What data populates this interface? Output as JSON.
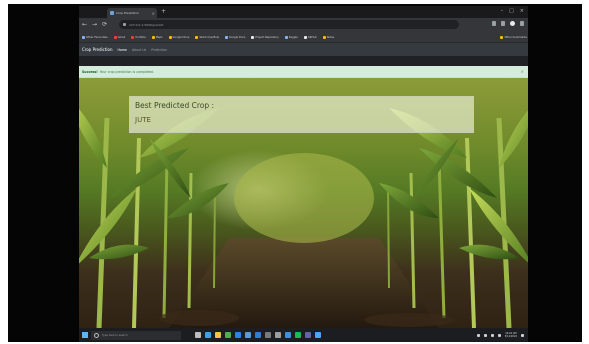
{
  "browser": {
    "tab_title": "Crop Prediction",
    "tab_close": "×",
    "new_tab": "+",
    "window_controls": [
      "–",
      "□",
      "×"
    ],
    "nav_buttons": [
      "←",
      "→",
      "⟳"
    ],
    "url": "127.0.0.1:5000/predict",
    "bookmarks": [
      {
        "label": "Other Favourites",
        "icon": "bookmark-folder-icon",
        "color": "#8ab4f8"
      },
      {
        "label": "Gmail",
        "icon": "gmail-icon",
        "color": "#ea4335"
      },
      {
        "label": "YouTube",
        "icon": "youtube-icon",
        "color": "#ea4335"
      },
      {
        "label": "Maps",
        "icon": "maps-icon",
        "color": "#fbbc04"
      },
      {
        "label": "Google Drive",
        "icon": "drive-icon",
        "color": "#fbbc04"
      },
      {
        "label": "Stack Overflow",
        "icon": "stackoverflow-icon",
        "color": "#fbbc04"
      },
      {
        "label": "Google Docs",
        "icon": "docs-icon",
        "color": "#8ab4f8"
      },
      {
        "label": "Project Repository",
        "icon": "repo-icon",
        "color": "#e8eaed"
      },
      {
        "label": "Kaggle",
        "icon": "kaggle-icon",
        "color": "#8ab4f8"
      },
      {
        "label": "GitHub",
        "icon": "github-icon",
        "color": "#e8eaed"
      },
      {
        "label": "Notes",
        "icon": "notes-icon",
        "color": "#fbbc04"
      }
    ],
    "bookmarks_right": "Other bookmarks"
  },
  "app": {
    "brand": "Crop Prediction",
    "nav": [
      "Home",
      "About Us",
      "Prediction"
    ]
  },
  "alert": {
    "strong": "Success!",
    "text": "Your crop prediction is completed.",
    "close": "×"
  },
  "result": {
    "title": "Best Predicted Crop :",
    "value": "JUTE"
  },
  "taskbar": {
    "search_placeholder": "Type here to search",
    "apps": [
      {
        "name": "task-view-icon",
        "color": "#bdbdbd"
      },
      {
        "name": "edge-icon",
        "color": "#3aa3e3"
      },
      {
        "name": "file-explorer-icon",
        "color": "#f2c14e"
      },
      {
        "name": "chrome-icon",
        "color": "#4caf50"
      },
      {
        "name": "vscode-icon",
        "color": "#2f80ed"
      },
      {
        "name": "store-icon",
        "color": "#5b9bd5"
      },
      {
        "name": "mail-icon",
        "color": "#2d7dd2"
      },
      {
        "name": "terminal-icon",
        "color": "#7a7a7a"
      },
      {
        "name": "settings-icon",
        "color": "#9e9e9e"
      },
      {
        "name": "photos-icon",
        "color": "#3f8fd8"
      },
      {
        "name": "spotify-icon",
        "color": "#1db954"
      },
      {
        "name": "teams-icon",
        "color": "#6264a7"
      },
      {
        "name": "notepad-icon",
        "color": "#4da3ff"
      }
    ],
    "time": "10:24 AM",
    "date": "5/12/2022"
  }
}
